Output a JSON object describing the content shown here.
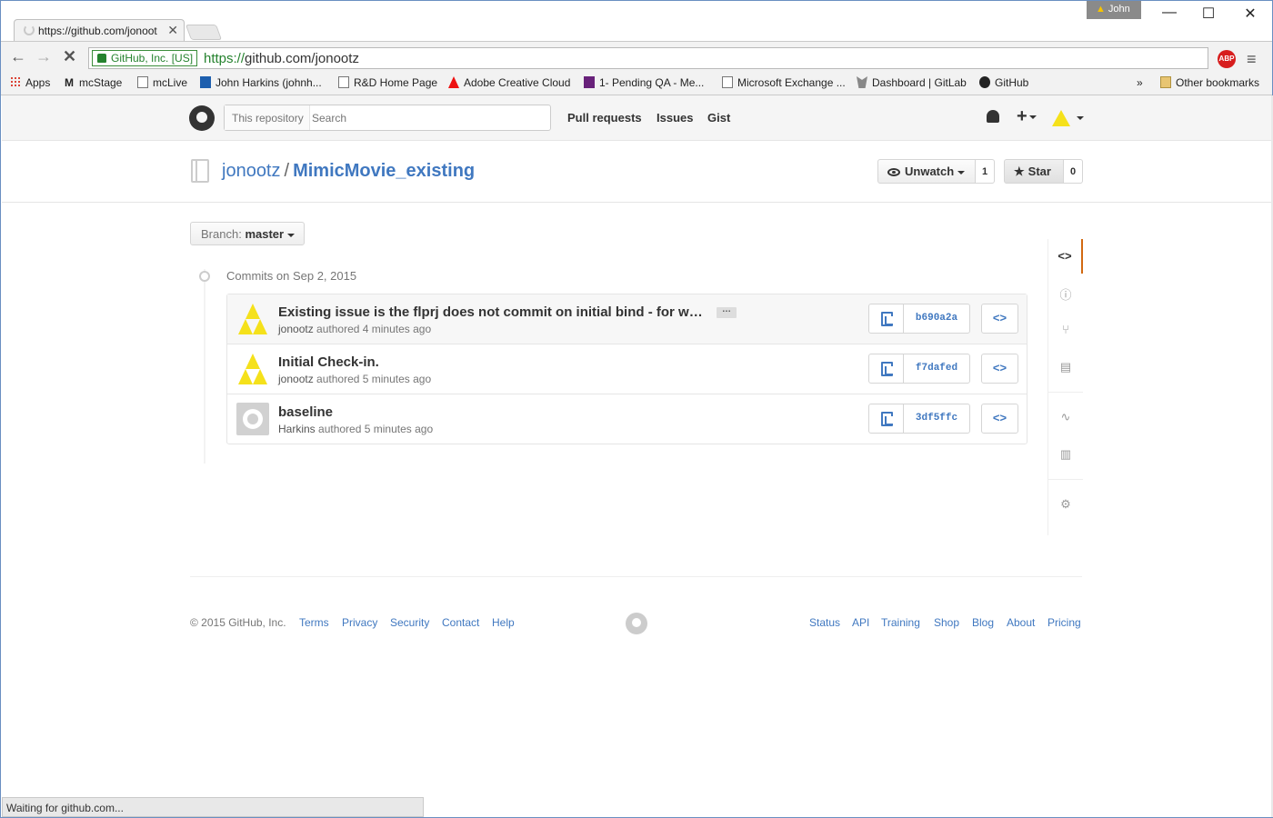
{
  "browser": {
    "tab_title": "https://github.com/jonoot",
    "tab_close": "✕",
    "profile_name": "John",
    "win_minimize": "—",
    "win_maximize": "☐",
    "win_close": "✕",
    "back": "←",
    "forward": "→",
    "stop": "✕",
    "ev_label": "GitHub, Inc. [US]",
    "url_scheme": "https://",
    "url_rest": "github.com/jonootz",
    "star": "☆",
    "abp": "ABP",
    "menu": "≡",
    "status": "Waiting for github.com..."
  },
  "bookmarks": {
    "items": [
      {
        "label": "Apps",
        "icon": "apps-icon"
      },
      {
        "label": "mcStage",
        "icon": "gmail-icon"
      },
      {
        "label": "mcLive",
        "icon": "page-icon"
      },
      {
        "label": "John Harkins (johnh...",
        "icon": "page-icon"
      },
      {
        "label": "R&D Home Page",
        "icon": "page-icon"
      },
      {
        "label": "Adobe Creative Cloud",
        "icon": "adobe-icon"
      },
      {
        "label": "1- Pending QA - Me...",
        "icon": "vs-icon"
      },
      {
        "label": "Microsoft Exchange ...",
        "icon": "page-icon"
      },
      {
        "label": "Dashboard | GitLab",
        "icon": "gitlab-icon"
      },
      {
        "label": "GitHub",
        "icon": "github-icon"
      }
    ],
    "overflow": "»",
    "other": "Other bookmarks"
  },
  "header": {
    "search_scope": "This repository",
    "search_placeholder": "Search",
    "nav": [
      "Pull requests",
      "Issues",
      "Gist"
    ],
    "plus": "+"
  },
  "repo": {
    "owner": "jonootz",
    "separator": "/",
    "name": "MimicMovie_existing",
    "unwatch_label": "Unwatch",
    "watch_count": "1",
    "star_label": "Star",
    "star_count": "0"
  },
  "branch": {
    "label": "Branch:",
    "value": "master"
  },
  "commits": {
    "date_header": "Commits on Sep 2, 2015",
    "items": [
      {
        "message": "Existing issue is the flprj does not commit on initial bind - for whe…",
        "author": "jonootz",
        "time": "authored 4 minutes ago",
        "sha": "b690a2a",
        "expand": "…",
        "avatar": "triforce-avatar"
      },
      {
        "message": "Initial Check-in.",
        "author": "jonootz",
        "time": "authored 5 minutes ago",
        "sha": "f7dafed",
        "avatar": "triforce-avatar"
      },
      {
        "message": "baseline",
        "author": "Harkins",
        "time": "authored 5 minutes ago",
        "sha": "3df5ffc",
        "avatar": "default-github-avatar"
      }
    ],
    "browse_label": "<>"
  },
  "sidebar": {
    "items": [
      {
        "name": "code-icon",
        "glyph": "<>"
      },
      {
        "name": "issues-icon",
        "glyph": "ⓘ"
      },
      {
        "name": "pull-requests-icon",
        "glyph": "⑂"
      },
      {
        "name": "wiki-icon",
        "glyph": "▤"
      },
      {
        "name": "pulse-icon",
        "glyph": "∿"
      },
      {
        "name": "graphs-icon",
        "glyph": "▥"
      },
      {
        "name": "settings-icon",
        "glyph": "⚙"
      }
    ]
  },
  "footer": {
    "copyright": "© 2015 GitHub, Inc.",
    "left_links": [
      "Terms",
      "Privacy",
      "Security",
      "Contact",
      "Help"
    ],
    "right_links": [
      "Status",
      "API",
      "Training",
      "Shop",
      "Blog",
      "About",
      "Pricing"
    ]
  },
  "colors": {
    "link": "#4078c0",
    "accent_orange": "#d26911",
    "ev_green": "#25822e",
    "avatar_yellow": "#f5e11b"
  }
}
